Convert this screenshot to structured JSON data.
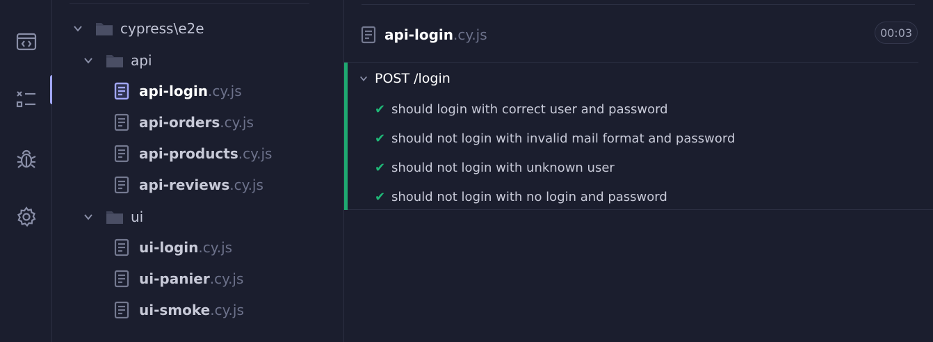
{
  "nav": {
    "items": [
      {
        "name": "specs",
        "icon": "code-window-icon"
      },
      {
        "name": "runs",
        "icon": "list-icon"
      },
      {
        "name": "debug",
        "icon": "bug-icon"
      },
      {
        "name": "settings",
        "icon": "gear-icon"
      }
    ],
    "active": "runs"
  },
  "spec_list": {
    "root_folder": "cypress\\e2e",
    "folders": [
      {
        "label": "api",
        "files": [
          {
            "name": "api-login",
            "ext": ".cy.js",
            "active": true
          },
          {
            "name": "api-orders",
            "ext": ".cy.js"
          },
          {
            "name": "api-products",
            "ext": ".cy.js"
          },
          {
            "name": "api-reviews",
            "ext": ".cy.js"
          }
        ]
      },
      {
        "label": "ui",
        "files": [
          {
            "name": "ui-login",
            "ext": ".cy.js"
          },
          {
            "name": "ui-panier",
            "ext": ".cy.js"
          },
          {
            "name": "ui-smoke",
            "ext": ".cy.js"
          }
        ]
      }
    ]
  },
  "runner": {
    "spec_name": "api-login",
    "spec_ext": ".cy.js",
    "duration": "00:03",
    "suite_title": "POST /login",
    "status_color": "#1fa971",
    "tests": [
      {
        "title": "should login with correct user and password",
        "status": "passed"
      },
      {
        "title": "should not login with invalid mail format and password",
        "status": "passed"
      },
      {
        "title": "should not login with unknown user",
        "status": "passed"
      },
      {
        "title": "should not login with no login and password",
        "status": "passed"
      }
    ],
    "check_glyph": "✔"
  }
}
